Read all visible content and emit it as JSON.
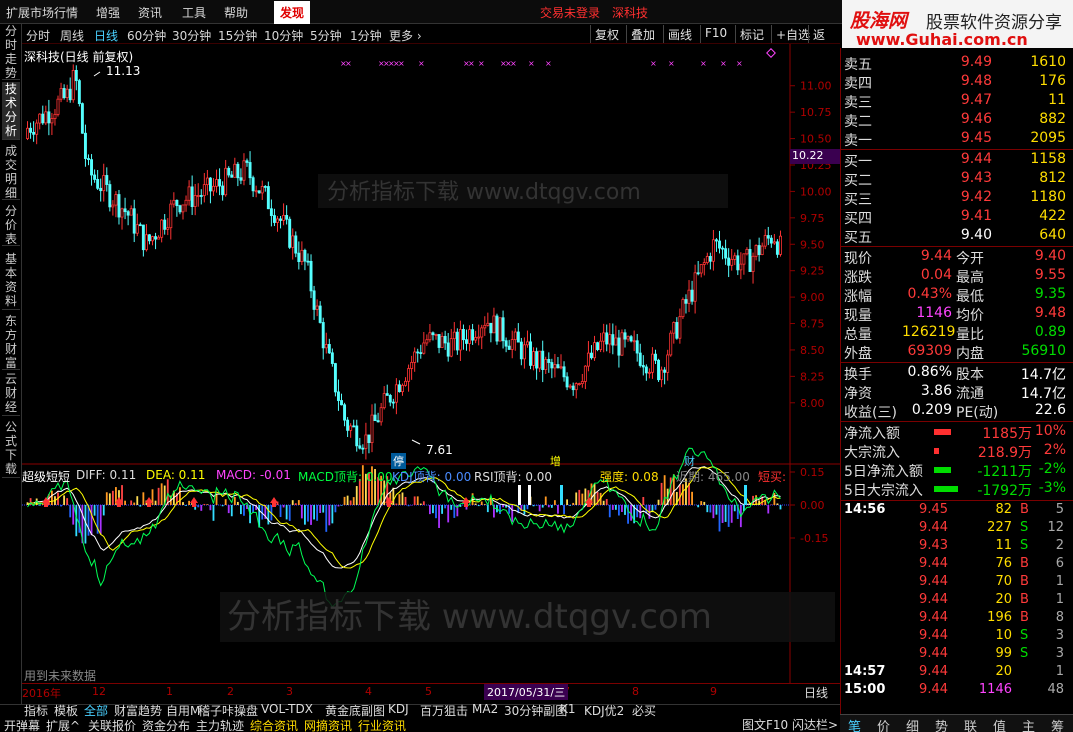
{
  "menu": {
    "items": [
      "扩展市场行情",
      "增强",
      "资讯",
      "工具",
      "帮助"
    ],
    "active": "发现",
    "center": "交易未登录",
    "stock": "深科技",
    "brand_logo": "股海网",
    "brand_slogan": "股票软件资源分享",
    "brand_url": "www.Guhai.com.cn"
  },
  "periods": [
    "分时",
    "周线",
    "日线",
    "60分钟",
    "30分钟",
    "15分钟",
    "10分钟",
    "5分钟",
    "1分钟",
    "更多 ›"
  ],
  "active_period": "日线",
  "tools": [
    "复权",
    "叠加",
    "画线",
    "F10",
    "标记",
    "+自选",
    "返回"
  ],
  "left_tabs": [
    {
      "label": "分时走势",
      "active": false
    },
    {
      "label": "技术分析",
      "active": true
    },
    {
      "label": "成交明细",
      "active": false
    },
    {
      "label": "分价表",
      "active": false
    },
    {
      "label": "基本资料",
      "active": false
    },
    {
      "label": "东方财富",
      "active": false
    },
    {
      "label": "云财经",
      "active": false
    },
    {
      "label": "公式下载",
      "active": false
    }
  ],
  "chart_title": "深科技(日线 前复权)",
  "kline": {
    "high_label": "11.13",
    "low_label": "7.61",
    "price_ticks": [
      "11.00",
      "10.75",
      "10.50",
      "10.25",
      "10.00",
      "9.75",
      "9.50",
      "9.25",
      "9.00",
      "8.75",
      "8.50",
      "8.25",
      "8.00"
    ],
    "current_price_box": "10.22",
    "event_markers": [
      "停",
      "增",
      "财"
    ]
  },
  "indicator": {
    "name": "超级短短",
    "diff": "DIFF: 0.11",
    "dea": "DEA: 0.11",
    "macd": "MACD: -0.01",
    "macd_top": "MACD顶背: 0.00",
    "kdj_top": "KDJ顶背: 0.00",
    "rsi_top": "RSI顶背: 0.00",
    "strength": "强度: 0.08",
    "recent": "近期: 465.00",
    "short_buy": "短买:",
    "ticks": [
      "0.15",
      "0.00",
      "-0.15"
    ],
    "future_data": "用到未来数据"
  },
  "xaxis": {
    "labels": [
      "2016年",
      "12",
      "1",
      "2",
      "3",
      "4",
      "5",
      "7",
      "8",
      "9"
    ],
    "cursor_date": "2017/05/31/三",
    "period": "日线"
  },
  "bottom_tabs_row1": [
    "指标",
    "模板",
    "全部",
    "财富趋势",
    "自用M",
    "稽子咔操盘",
    "VOL-TDX",
    "黄金底副图",
    "KDJ",
    "百万狙击",
    "MA2",
    "30分钟副图",
    "K1",
    "KDJ优2",
    "必买"
  ],
  "bottom_tabs_row2": [
    "开弹幕",
    "扩展^",
    "关联报价",
    "资金分布",
    "主力轨迹",
    "综合资讯",
    "网摘资讯",
    "行业资讯"
  ],
  "bottom_right": [
    "图文F10",
    "闪达栏>"
  ],
  "orderbook": {
    "sell": [
      {
        "label": "卖五",
        "price": "9.49",
        "vol": "1610"
      },
      {
        "label": "卖四",
        "price": "9.48",
        "vol": "176"
      },
      {
        "label": "卖三",
        "price": "9.47",
        "vol": "11"
      },
      {
        "label": "卖二",
        "price": "9.46",
        "vol": "882"
      },
      {
        "label": "卖一",
        "price": "9.45",
        "vol": "2095"
      }
    ],
    "buy": [
      {
        "label": "买一",
        "price": "9.44",
        "vol": "1158"
      },
      {
        "label": "买二",
        "price": "9.43",
        "vol": "812"
      },
      {
        "label": "买三",
        "price": "9.42",
        "vol": "1180"
      },
      {
        "label": "买四",
        "price": "9.41",
        "vol": "422"
      },
      {
        "label": "买五",
        "price": "9.40",
        "vol": "640"
      }
    ]
  },
  "quote": [
    {
      "l1": "现价",
      "v1": "9.44",
      "c1": "red",
      "l2": "今开",
      "v2": "9.40",
      "c2": "red"
    },
    {
      "l1": "涨跌",
      "v1": "0.04",
      "c1": "red",
      "l2": "最高",
      "v2": "9.55",
      "c2": "red"
    },
    {
      "l1": "涨幅",
      "v1": "0.43%",
      "c1": "red",
      "l2": "最低",
      "v2": "9.35",
      "c2": "green"
    },
    {
      "l1": "现量",
      "v1": "1146",
      "c1": "mag",
      "l2": "均价",
      "v2": "9.48",
      "c2": "red"
    },
    {
      "l1": "总量",
      "v1": "126219",
      "c1": "yellow",
      "l2": "量比",
      "v2": "0.89",
      "c2": "green"
    },
    {
      "l1": "外盘",
      "v1": "69309",
      "c1": "red",
      "l2": "内盘",
      "v2": "56910",
      "c2": "green"
    }
  ],
  "fundamentals": [
    {
      "l1": "换手",
      "v1": "0.86%",
      "l2": "股本",
      "v2": "14.7亿"
    },
    {
      "l1": "净资",
      "v1": "3.86",
      "l2": "流通",
      "v2": "14.7亿"
    },
    {
      "l1": "收益(三)",
      "v1": "0.209",
      "l2": "PE(动)",
      "v2": "22.6"
    }
  ],
  "flows": [
    {
      "label": "净流入额",
      "value": "1185万",
      "pct": "10%",
      "color": "red",
      "bar": 0.28
    },
    {
      "label": "大宗流入",
      "value": "218.9万",
      "pct": "2%",
      "color": "red",
      "bar": 0.08
    },
    {
      "label": "5日净流入额",
      "value": "-1211万",
      "pct": "-2%",
      "color": "green",
      "bar": 0.28
    },
    {
      "label": "5日大宗流入",
      "value": "-1792万",
      "pct": "-3%",
      "color": "green",
      "bar": 0.4
    }
  ],
  "ticks": [
    {
      "time": "14:56",
      "price": "9.45",
      "vol": "82",
      "bs": "B",
      "n": "5"
    },
    {
      "time": "",
      "price": "9.44",
      "vol": "227",
      "bs": "S",
      "n": "12"
    },
    {
      "time": "",
      "price": "9.43",
      "vol": "11",
      "bs": "S",
      "n": "2"
    },
    {
      "time": "",
      "price": "9.44",
      "vol": "76",
      "bs": "B",
      "n": "6"
    },
    {
      "time": "",
      "price": "9.44",
      "vol": "70",
      "bs": "B",
      "n": "1"
    },
    {
      "time": "",
      "price": "9.44",
      "vol": "20",
      "bs": "B",
      "n": "1"
    },
    {
      "time": "",
      "price": "9.44",
      "vol": "196",
      "bs": "B",
      "n": "8"
    },
    {
      "time": "",
      "price": "9.44",
      "vol": "10",
      "bs": "S",
      "n": "3"
    },
    {
      "time": "",
      "price": "9.44",
      "vol": "99",
      "bs": "S",
      "n": "3"
    },
    {
      "time": "14:57",
      "price": "9.44",
      "vol": "20",
      "bs": "",
      "n": "1"
    },
    {
      "time": "15:00",
      "price": "9.44",
      "vol": "1146",
      "bs": "",
      "n": "48"
    }
  ],
  "side_tabs": [
    "笔",
    "价",
    "细",
    "势",
    "联",
    "值",
    "主",
    "筹"
  ],
  "watermark": "分析指标下载 www.dtqgv.com"
}
